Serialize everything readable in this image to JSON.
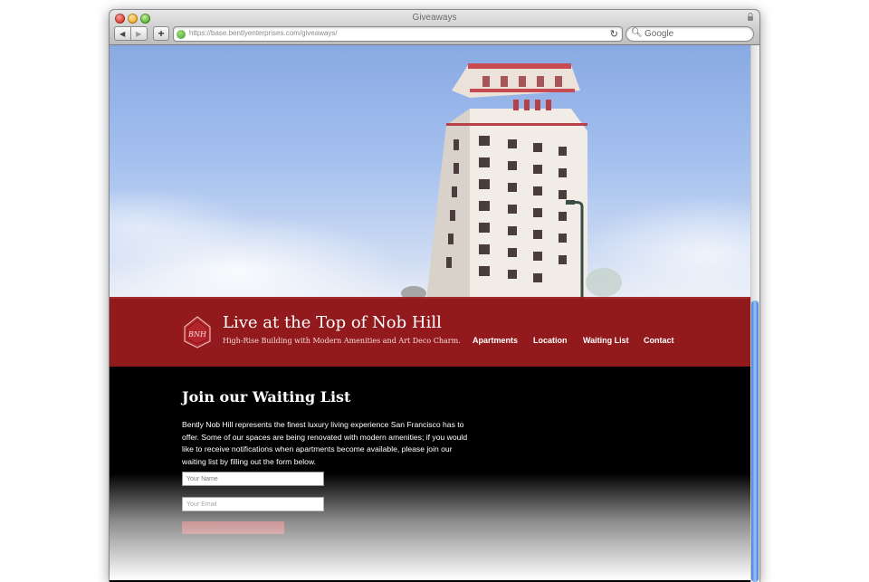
{
  "window": {
    "title": "Giveaways"
  },
  "toolbar": {
    "back_label": "◀",
    "forward_label": "▶",
    "add_label": "+",
    "url": "https://base.bentlyenterprises.com/giveaways/",
    "reload_label": "↻",
    "search_placeholder": "Google"
  },
  "site": {
    "logo_letters": "BNH",
    "title": "Live at the Top of Nob Hill",
    "tagline": "High-Rise Building with Modern Amenities and Art Deco Charm."
  },
  "nav": {
    "items": [
      "Apartments",
      "Location",
      "Waiting List",
      "Contact"
    ]
  },
  "waiting_list": {
    "heading": "Join our Waiting List",
    "body": "Bently Nob Hill represents the finest luxury living experience San Francisco has to offer. Some of our spaces are being renovated with modern amenities; if you would like to receive notifications when apartments become available, please join our waiting list by filling out the form below.",
    "name_placeholder": "Your Name",
    "email_placeholder": "Your Email"
  },
  "colors": {
    "banner_red": "#9e1c1e",
    "content_bg": "#000000",
    "scroll_blue": "#3f7ad8"
  },
  "icons": [
    "close-light",
    "minimize-light",
    "zoom-light",
    "lock-icon",
    "globe-icon",
    "reload-icon",
    "search-icon",
    "logo-shield-icon"
  ]
}
